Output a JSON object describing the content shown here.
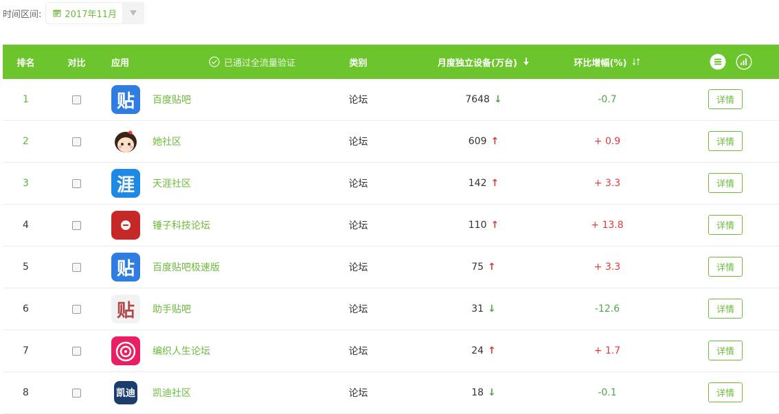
{
  "filter": {
    "label": "时间区间:",
    "value": "2017年11月"
  },
  "table": {
    "headers": {
      "rank": "排名",
      "compare": "对比",
      "app": "应用",
      "verified": "已通过全流量验证",
      "category": "类别",
      "devices": "月度独立设备(万台)",
      "change": "环比增幅(%)"
    },
    "rows": [
      {
        "rank": "1",
        "name": "百度贴吧",
        "category": "论坛",
        "devices": "7648",
        "trend": "down",
        "change": "-0.7",
        "icon": "tieba-icon",
        "icon_bg": "#2f7de1",
        "icon_text": "贴"
      },
      {
        "rank": "2",
        "name": "她社区",
        "category": "论坛",
        "devices": "609",
        "trend": "up",
        "change": "+ 0.9",
        "icon": "tashequ-icon",
        "icon_bg": "#ffffff",
        "icon_text": ""
      },
      {
        "rank": "3",
        "name": "天涯社区",
        "category": "论坛",
        "devices": "142",
        "trend": "up",
        "change": "+ 3.3",
        "icon": "tianya-icon",
        "icon_bg": "#1e88e5",
        "icon_text": "涯"
      },
      {
        "rank": "4",
        "name": "锤子科技论坛",
        "category": "论坛",
        "devices": "110",
        "trend": "up",
        "change": "+ 13.8",
        "icon": "smartisan-icon",
        "icon_bg": "#c62828",
        "icon_text": ""
      },
      {
        "rank": "5",
        "name": "百度贴吧极速版",
        "category": "论坛",
        "devices": "75",
        "trend": "up",
        "change": "+ 3.3",
        "icon": "tieba-lite-icon",
        "icon_bg": "#2f7de1",
        "icon_text": "贴"
      },
      {
        "rank": "6",
        "name": "助手贴吧",
        "category": "论坛",
        "devices": "31",
        "trend": "down",
        "change": "-12.6",
        "icon": "zhushou-tieba-icon",
        "icon_bg": "#f2f2f2",
        "icon_text": "贴"
      },
      {
        "rank": "7",
        "name": "编织人生论坛",
        "category": "论坛",
        "devices": "24",
        "trend": "up",
        "change": "+ 1.7",
        "icon": "bianzhi-icon",
        "icon_bg": "#e91e63",
        "icon_text": ""
      },
      {
        "rank": "8",
        "name": "凯迪社区",
        "category": "论坛",
        "devices": "18",
        "trend": "down",
        "change": "-0.1",
        "icon": "kaidi-icon",
        "icon_bg": "#ffffff",
        "icon_text": "凯迪"
      }
    ],
    "detail_label": "详情"
  },
  "colors": {
    "accent": "#6cc52c",
    "up": "#e03a3a",
    "down": "#4fa64a"
  }
}
